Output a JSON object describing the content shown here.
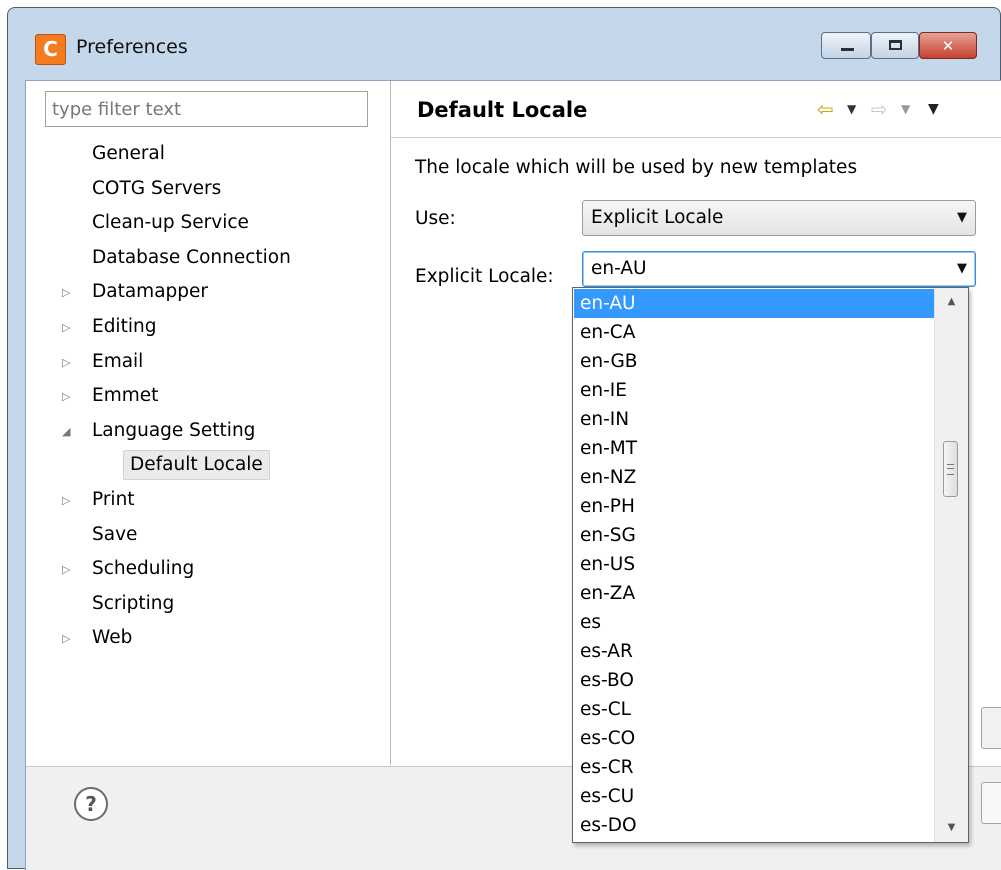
{
  "window": {
    "title": "Preferences",
    "app_icon_letter": "C",
    "controls": {
      "minimize": "",
      "maximize": "",
      "close": "✕"
    }
  },
  "filter": {
    "placeholder": "type filter text",
    "value": ""
  },
  "tree": {
    "items": [
      {
        "label": "General",
        "expandable": false,
        "expanded": false,
        "twisty": ""
      },
      {
        "label": "COTG Servers",
        "expandable": false,
        "expanded": false,
        "twisty": ""
      },
      {
        "label": "Clean-up Service",
        "expandable": false,
        "expanded": false,
        "twisty": ""
      },
      {
        "label": "Database Connection",
        "expandable": false,
        "expanded": false,
        "twisty": ""
      },
      {
        "label": "Datamapper",
        "expandable": true,
        "expanded": false,
        "twisty": "▷"
      },
      {
        "label": "Editing",
        "expandable": true,
        "expanded": false,
        "twisty": "▷"
      },
      {
        "label": "Email",
        "expandable": true,
        "expanded": false,
        "twisty": "▷"
      },
      {
        "label": "Emmet",
        "expandable": true,
        "expanded": false,
        "twisty": "▷"
      },
      {
        "label": "Language Setting",
        "expandable": true,
        "expanded": true,
        "twisty": "◢"
      },
      {
        "label": "Default Locale",
        "child": true,
        "selected": true
      },
      {
        "label": "Print",
        "expandable": true,
        "expanded": false,
        "twisty": "▷"
      },
      {
        "label": "Save",
        "expandable": false,
        "expanded": false,
        "twisty": ""
      },
      {
        "label": "Scheduling",
        "expandable": true,
        "expanded": false,
        "twisty": "▷"
      },
      {
        "label": "Scripting",
        "expandable": false,
        "expanded": false,
        "twisty": ""
      },
      {
        "label": "Web",
        "expandable": true,
        "expanded": false,
        "twisty": "▷"
      }
    ]
  },
  "page": {
    "title": "Default Locale",
    "description": "The locale which will be used by new templates",
    "nav": {
      "back": "⇦",
      "back_menu": "▼",
      "forward": "⇨",
      "forward_menu": "▼",
      "view_menu": "▼"
    },
    "use": {
      "label": "Use:",
      "value": "Explicit Locale"
    },
    "explicit_locale": {
      "label": "Explicit Locale:",
      "value": "en-AU"
    }
  },
  "dropdown": {
    "selected": "en-AU",
    "options": [
      "en-AU",
      "en-CA",
      "en-GB",
      "en-IE",
      "en-IN",
      "en-MT",
      "en-NZ",
      "en-PH",
      "en-SG",
      "en-US",
      "en-ZA",
      "es",
      "es-AR",
      "es-BO",
      "es-CL",
      "es-CO",
      "es-CR",
      "es-CU",
      "es-DO"
    ],
    "scroll_up": "▲",
    "scroll_down": "▼"
  },
  "help": {
    "glyph": "?"
  },
  "colors": {
    "selection": "#3399ff",
    "window_frame": "#c5d7ea",
    "close_button": "#c6412f",
    "app_icon": "#f47b20",
    "nav_arrow": "#d4a017"
  }
}
